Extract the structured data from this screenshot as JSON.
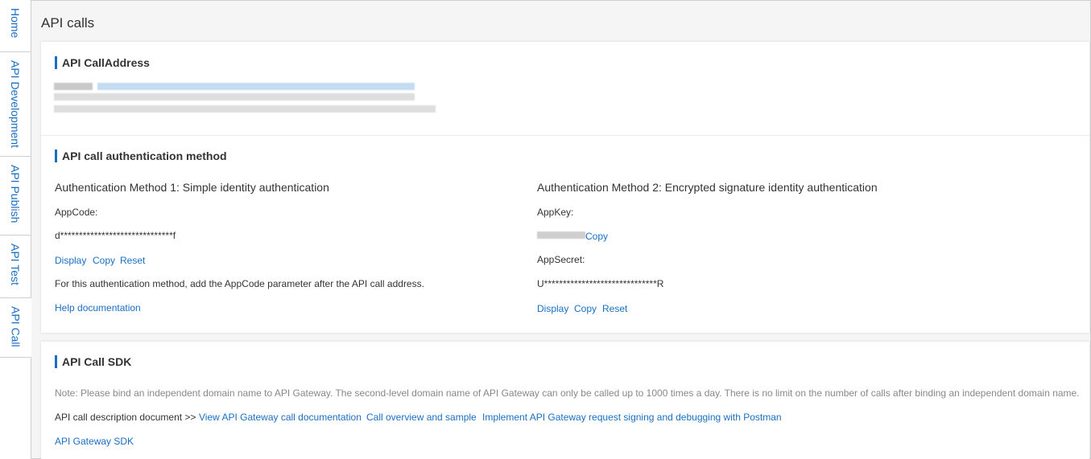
{
  "tabs": [
    {
      "label": "Home"
    },
    {
      "label": "API Development"
    },
    {
      "label": "API Publish"
    },
    {
      "label": "API Test"
    },
    {
      "label": "API Call"
    }
  ],
  "page": {
    "title": "API calls"
  },
  "call_address": {
    "title": "API CallAddress"
  },
  "auth": {
    "title": "API call authentication method",
    "method1": {
      "heading": "Authentication Method 1: Simple identity authentication",
      "appcode_label": "AppCode:",
      "appcode_value": "d******************************f",
      "display": "Display",
      "copy": "Copy",
      "reset": "Reset",
      "description": "For this authentication method, add the AppCode parameter after the API call address.",
      "help": "Help documentation"
    },
    "method2": {
      "heading": "Authentication Method 2: Encrypted signature identity authentication",
      "appkey_label": "AppKey:",
      "appkey_copy": "Copy",
      "appsecret_label": "AppSecret:",
      "appsecret_value": "U******************************R",
      "display": "Display",
      "copy": "Copy",
      "reset": "Reset"
    }
  },
  "sdk": {
    "title": "API Call SDK",
    "note": "Note: Please bind an independent domain name to API Gateway. The second-level domain name of API Gateway can only be called up to 1000 times a day. There is no limit on the number of calls after binding an independent domain name.",
    "doc_prefix": "API call description document >>",
    "doc_link1": "View API Gateway call documentation",
    "doc_link2": "Call overview and sample",
    "doc_link3": "Implement API Gateway request signing and debugging with Postman",
    "sdk_link": "API Gateway SDK"
  },
  "colors": {
    "accent": "#1b6ec2",
    "border": "#cfcfcf",
    "background": "#f5f5f5"
  }
}
